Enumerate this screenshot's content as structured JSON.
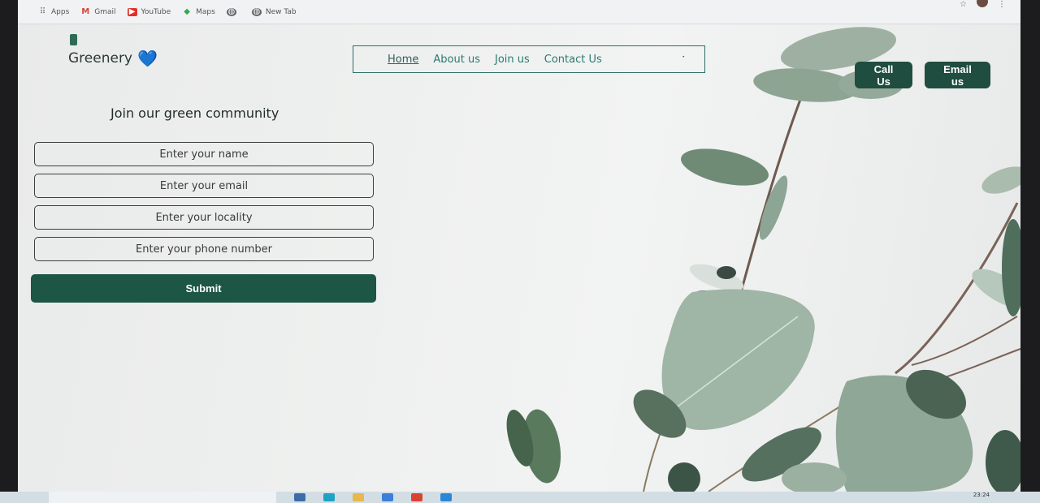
{
  "browser": {
    "bookmarks": [
      {
        "label": "Apps",
        "icon": "apps-grid-icon"
      },
      {
        "label": "Gmail",
        "icon": "gmail-icon"
      },
      {
        "label": "YouTube",
        "icon": "youtube-icon"
      },
      {
        "label": "Maps",
        "icon": "maps-icon"
      },
      {
        "label": "",
        "icon": "globe-icon"
      },
      {
        "label": "New Tab",
        "icon": "globe-icon"
      }
    ]
  },
  "site": {
    "brand": {
      "name": "Greenery",
      "emoji": "💙"
    },
    "nav": [
      {
        "label": "Home",
        "active": true
      },
      {
        "label": "About us"
      },
      {
        "label": "Join us"
      },
      {
        "label": "Contact Us"
      }
    ],
    "header_buttons": {
      "call": "Call Us",
      "email": "Email us"
    },
    "form": {
      "title": "Join our green community",
      "name_placeholder": "Enter your name",
      "email_placeholder": "Enter your email",
      "locality_placeholder": "Enter your locality",
      "phone_placeholder": "Enter your phone number",
      "submit_label": "Submit"
    }
  },
  "taskbar": {
    "time": "23:24"
  },
  "colors": {
    "accent": "#1d5644",
    "nav_link": "#2a7a70",
    "heart": "#2e73b8"
  }
}
